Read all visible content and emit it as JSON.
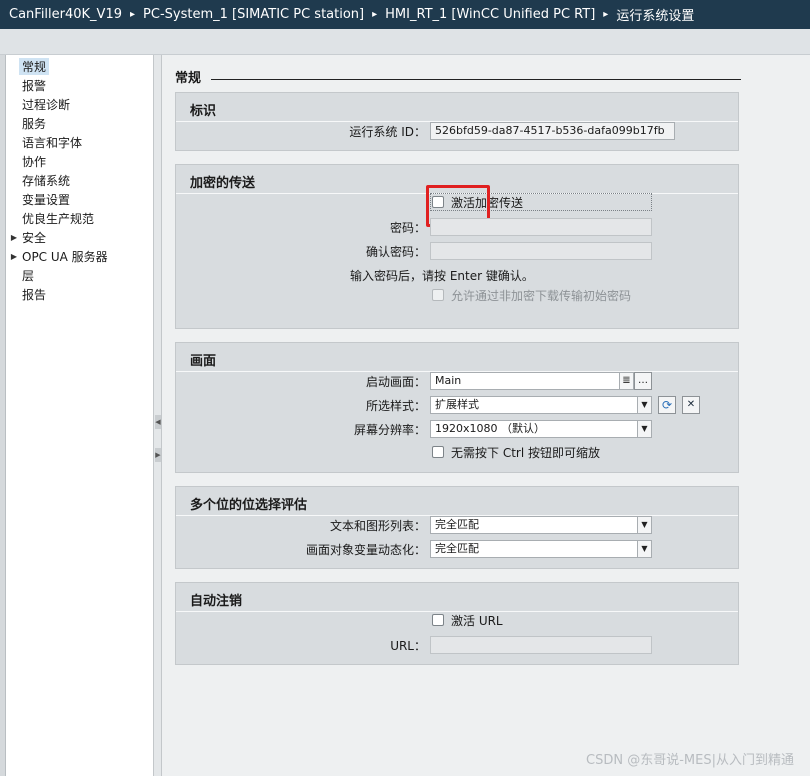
{
  "breadcrumb": {
    "items": [
      "CanFiller40K_V19",
      "PC-System_1 [SIMATIC PC station]",
      "HMI_RT_1 [WinCC Unified PC RT]",
      "运行系统设置"
    ],
    "separator": "▸"
  },
  "nav": {
    "items": [
      {
        "label": "常规",
        "expandable": false,
        "selected": true
      },
      {
        "label": "报警",
        "expandable": false
      },
      {
        "label": "过程诊断",
        "expandable": false
      },
      {
        "label": "服务",
        "expandable": false
      },
      {
        "label": "语言和字体",
        "expandable": false
      },
      {
        "label": "协作",
        "expandable": false
      },
      {
        "label": "存储系统",
        "expandable": false
      },
      {
        "label": "变量设置",
        "expandable": false
      },
      {
        "label": "优良生产规范",
        "expandable": false
      },
      {
        "label": "安全",
        "expandable": true
      },
      {
        "label": "OPC UA 服务器",
        "expandable": true
      },
      {
        "label": "层",
        "expandable": false
      },
      {
        "label": "报告",
        "expandable": false
      }
    ]
  },
  "section": {
    "title": "常规"
  },
  "identification": {
    "title": "标识",
    "runtime_id_label": "运行系统 ID：",
    "runtime_id_value": "526bfd59-da87-4517-b536-dafa099b17fb"
  },
  "encryption": {
    "title": "加密的传送",
    "activate_label": "激活加密传送",
    "activate_checked": false,
    "password_label": "密码：",
    "password_value": "",
    "confirm_label": "确认密码：",
    "confirm_value": "",
    "hint": "输入密码后，请按 Enter 键确认。",
    "allow_label": "允许通过非加密下载传输初始密码"
  },
  "screen": {
    "title": "画面",
    "start_label": "启动画面：",
    "start_value": "Main",
    "style_label": "所选样式：",
    "style_value": "扩展样式",
    "resolution_label": "屏幕分辨率：",
    "resolution_value": "1920x1080 （默认）",
    "zoom_label": "无需按下 Ctrl 按钮即可缩放",
    "zoom_checked": false
  },
  "bitselect": {
    "title": "多个位的位选择评估",
    "textlist_label": "文本和图形列表：",
    "textlist_value": "完全匹配",
    "dynamize_label": "画面对象变量动态化：",
    "dynamize_value": "完全匹配"
  },
  "autologout": {
    "title": "自动注销",
    "url_checkbox_label": "激活 URL",
    "url_checked": false,
    "url_label": "URL：",
    "url_value": ""
  },
  "icons": {
    "browse": "list-icon",
    "more": "ellipsis-icon",
    "refresh": "refresh-icon",
    "delete": "x-icon",
    "dropdown": "triangle-down-icon"
  },
  "watermark": "CSDN @东哥说-MES|从入门到精通",
  "colors": {
    "titlebar": "#1f3a4e",
    "highlight": "#e02020",
    "group_bg": "#d8dcdf"
  }
}
